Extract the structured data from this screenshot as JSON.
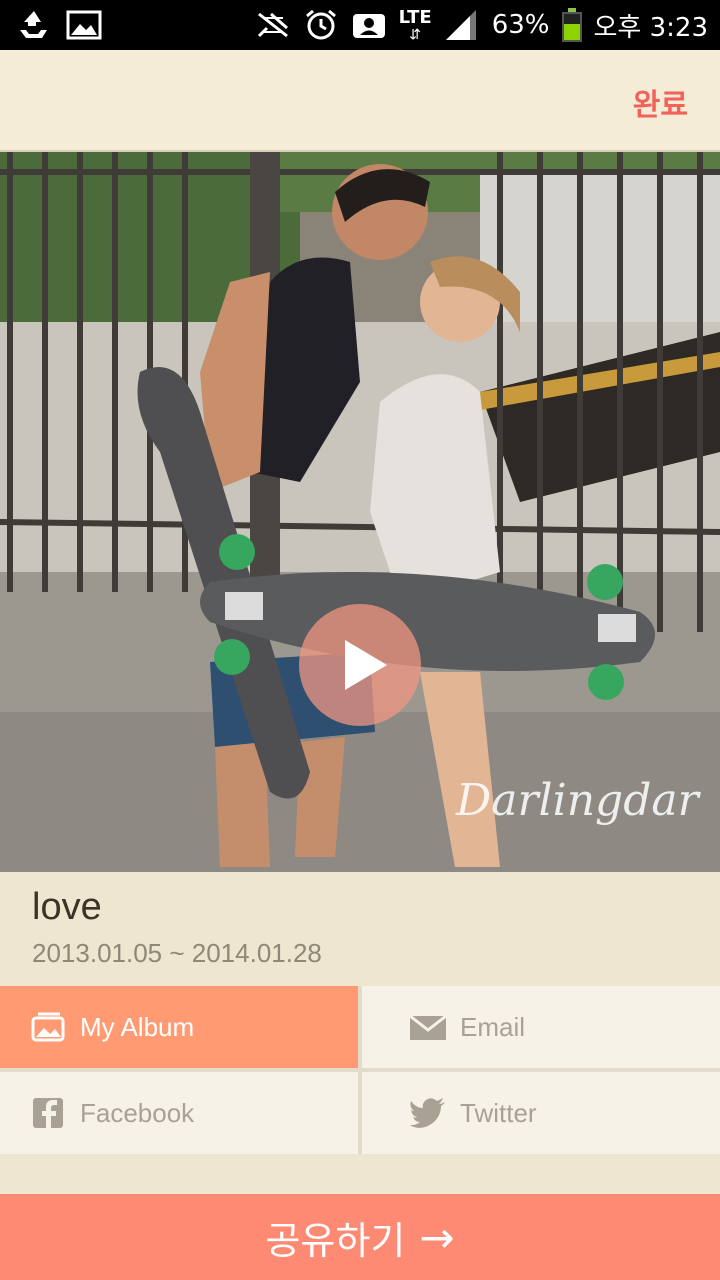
{
  "status_bar": {
    "lte": "LTE",
    "battery": "63%",
    "time": "오후 3:23",
    "battery_level": 0.63,
    "icons": [
      "recycle-icon",
      "image-icon",
      "nfc-icon",
      "alarm-icon",
      "contact-icon",
      "signal-icon",
      "battery-icon"
    ]
  },
  "header": {
    "done_label": "완료"
  },
  "photo": {
    "watermark": "Darlingdar"
  },
  "album": {
    "title": "love",
    "dates": "2013.01.05 ~ 2014.01.28"
  },
  "share_options": {
    "my_album": "My Album",
    "email": "Email",
    "facebook": "Facebook",
    "twitter": "Twitter"
  },
  "share_button": {
    "label": "공유하기",
    "arrow": "→"
  },
  "colors": {
    "accent": "#ff8a73",
    "active_option": "#ff9a73",
    "done": "#f0625a",
    "background": "#efe6d0"
  }
}
